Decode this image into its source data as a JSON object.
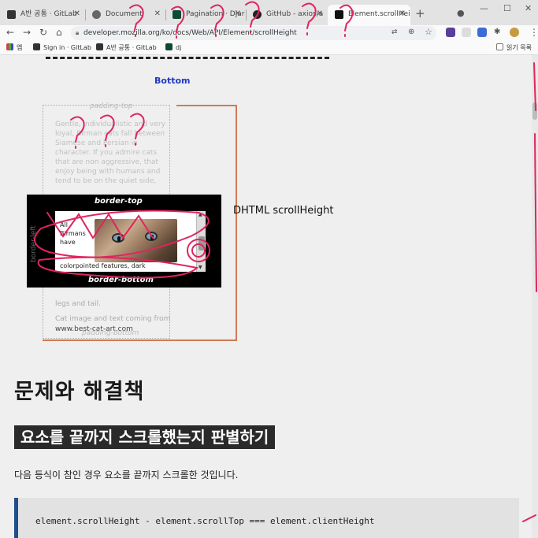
{
  "browser": {
    "tabs": [
      {
        "title": "A반 공통 · GitLab",
        "active": false
      },
      {
        "title": "Document",
        "active": false
      },
      {
        "title": "Pagination · Djar",
        "active": false
      },
      {
        "title": "GitHub - axios/a",
        "active": false
      },
      {
        "title": "Element.scrollHei",
        "active": true
      }
    ],
    "new_tab": "+",
    "url": "developer.mozilla.org/ko/docs/Web/API/Element/scrollHeight",
    "bookmarks": [
      {
        "label": "앱"
      },
      {
        "label": "Sign in · GitLab"
      },
      {
        "label": "A반 공통 · GitLab"
      },
      {
        "label": "dj"
      }
    ],
    "reading_list": "읽기 목록"
  },
  "diagram": {
    "bottom_label": "Bottom",
    "padding_top": "padding-top",
    "padding_bottom": "padding-bottom",
    "faint_text": "Gentle, individualistic and very loyal, Birman cats fall between Siamese and Persian in character. If you admire cats that are non aggressive, that enjoy being with humans and tend to be on the quiet side,",
    "border_top": "border-top",
    "border_bottom": "border-bottom",
    "border_left": "border-left",
    "inner_text": "All Birmans have",
    "inner_footer": "colorpointed features, dark",
    "below_text": "legs and tail.",
    "credit_prefix": "Cat image and text coming from",
    "credit_site": "www.best-cat-art.com",
    "dhtml_label": "DHTML scrollHeight"
  },
  "content": {
    "heading": "문제와 해결책",
    "subheading": "요소를 끝까지 스크롤했는지 판별하기",
    "paragraph": "다음 등식이 참인 경우 요소를 끝까지 스크롤한 것입니다.",
    "code": "element.scrollHeight - element.scrollTop === element.clientHeight"
  },
  "colors": {
    "ink": "#e0245e",
    "code_border": "#1e4e8c",
    "diagram_border": "#d07a55"
  }
}
